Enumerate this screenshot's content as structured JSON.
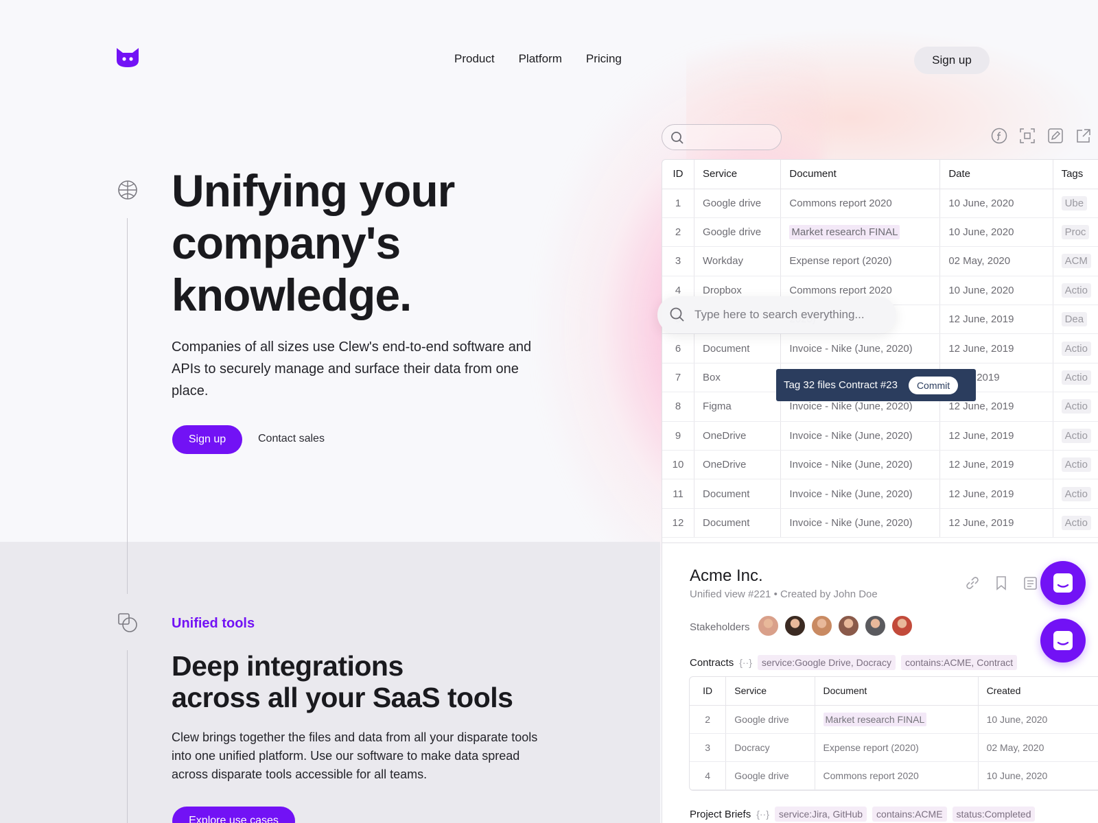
{
  "nav": {
    "items": [
      "Product",
      "Platform",
      "Pricing"
    ],
    "signup": "Sign up"
  },
  "hero": {
    "title": "Unifying your company's knowledge.",
    "description": "Companies of all sizes use Clew's end-to-end software and APIs to securely manage and surface their data from one place.",
    "primary_cta": "Sign up",
    "secondary_cta": "Contact sales"
  },
  "section2": {
    "eyebrow": "Unified tools",
    "title_line1": "Deep integrations",
    "title_line2": "across all your SaaS tools",
    "description": "Clew brings together the files and data from all your disparate tools into one unified platform. Use our software to make data spread across disparate tools accessible for all teams.",
    "cta": "Explore use cases"
  },
  "table": {
    "columns": [
      "ID",
      "Service",
      "Document",
      "Date",
      "Tags"
    ],
    "rows": [
      [
        "1",
        "Google drive",
        "Commons report 2020",
        "10 June, 2020",
        "Ube"
      ],
      [
        "2",
        "Google drive",
        "Market research FINAL",
        "10 June, 2020",
        "Proc"
      ],
      [
        "3",
        "Workday",
        "Expense report (2020)",
        "02 May, 2020",
        "ACM"
      ],
      [
        "4",
        "Dropbox",
        "Commons report 2020",
        "10 June, 2020",
        "Actio"
      ],
      [
        "5",
        "",
        "2020)",
        "12 June, 2019",
        "Dea"
      ],
      [
        "6",
        "Document",
        "Invoice - Nike (June, 2020)",
        "12 June, 2019",
        "Actio"
      ],
      [
        "7",
        "Box",
        "",
        "June, 2019",
        "Actio"
      ],
      [
        "8",
        "Figma",
        "Invoice - Nike (June, 2020)",
        "12 June, 2019",
        "Actio"
      ],
      [
        "9",
        "OneDrive",
        "Invoice - Nike (June, 2020)",
        "12 June, 2019",
        "Actio"
      ],
      [
        "10",
        "OneDrive",
        "Invoice - Nike (June, 2020)",
        "12 June, 2019",
        "Actio"
      ],
      [
        "11",
        "Document",
        "Invoice - Nike (June, 2020)",
        "12 June, 2019",
        "Actio"
      ],
      [
        "12",
        "Document",
        "Invoice - Nike (June, 2020)",
        "12 June, 2019",
        "Actio"
      ]
    ],
    "search_placeholder": "Type here to search everything...",
    "toast_text": "Tag 32 files Contract #23",
    "toast_button": "Commit"
  },
  "detail": {
    "title": "Acme Inc.",
    "subtitle": "Unified view #221 • Created by John Doe",
    "stakeholders_label": "Stakeholders",
    "avatar_colors": [
      "#d9a08a",
      "#3b2a22",
      "#c98a62",
      "#8a5a4a",
      "#5a5a5e",
      "#c24a3a"
    ],
    "contracts_label": "Contracts",
    "contracts_chips": [
      "service:Google Drive, Docracy",
      "contains:ACME, Contract"
    ],
    "contracts_table": {
      "columns": [
        "ID",
        "Service",
        "Document",
        "Created"
      ],
      "rows": [
        [
          "2",
          "Google drive",
          "Market research FINAL",
          "10 June, 2020"
        ],
        [
          "3",
          "Docracy",
          "Expense report (2020)",
          "02 May, 2020"
        ],
        [
          "4",
          "Google drive",
          "Commons report 2020",
          "10 June, 2020"
        ]
      ]
    },
    "briefs_label": "Project Briefs",
    "briefs_chips": [
      "service:Jira, GitHub",
      "contains:ACME",
      "status:Completed"
    ],
    "brace_symbol": "{··}"
  },
  "colors": {
    "brand": "#7212f5",
    "toast": "#2b3d5e"
  }
}
